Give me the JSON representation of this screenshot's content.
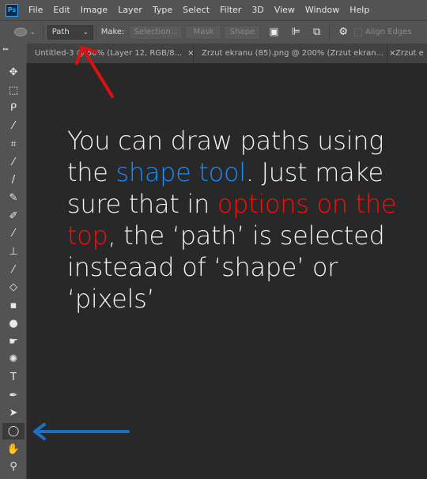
{
  "menubar": {
    "logo": "Ps",
    "items": [
      "File",
      "Edit",
      "Image",
      "Layer",
      "Type",
      "Select",
      "Filter",
      "3D",
      "View",
      "Window",
      "Help"
    ]
  },
  "options": {
    "mode": "Path",
    "make_label": "Make:",
    "selection": "Selection...",
    "mask": "Mask",
    "shape": "Shape",
    "align_edges": "Align Edges"
  },
  "tabs": [
    {
      "label": "Untitled-3 @ 50% (Layer 12, RGB/8...",
      "close": "×"
    },
    {
      "label": "Zrzut ekranu (85).png @ 200% (Zrzut ekran...",
      "close": "×"
    },
    {
      "label": "Zrzut e"
    }
  ],
  "tools": [
    "move",
    "marquee",
    "lasso",
    "magic-wand",
    "crop",
    "eyedropper",
    "brush",
    "pencil",
    "healing",
    "mixer-brush",
    "clone-stamp",
    "history-brush",
    "eraser",
    "gradient",
    "blur",
    "dodge",
    "sponge",
    "type",
    "pen",
    "path-selection",
    "ellipse",
    "hand",
    "zoom"
  ],
  "tool_glyphs": [
    "✥",
    "⬚",
    "ᑭ",
    "⁄",
    "⌗",
    "⁄",
    "/",
    "✎",
    "✐",
    "⁄",
    "⊥",
    "⁄",
    "◇",
    "▪",
    "●",
    "☛",
    "✺",
    "T",
    "✒",
    "➤",
    "◯",
    "✋",
    "⚲"
  ],
  "active_tool": "ellipse",
  "annotation": {
    "l1": "You can draw paths using",
    "l2a": "the ",
    "l2b": "shape tool",
    "l2c": ". Just make",
    "l3": "sure that in ",
    "l3b": "options on the",
    "l4a": "top",
    "l4b": ", the ‘path’ is selected",
    "l5": "insteaad of ‘shape’ or",
    "l6": "‘pixels’"
  },
  "colors": {
    "blue": "#1a8cff",
    "red": "#ff0d0d",
    "arrow_red": "#e01010",
    "arrow_blue": "#1e6fc0"
  }
}
